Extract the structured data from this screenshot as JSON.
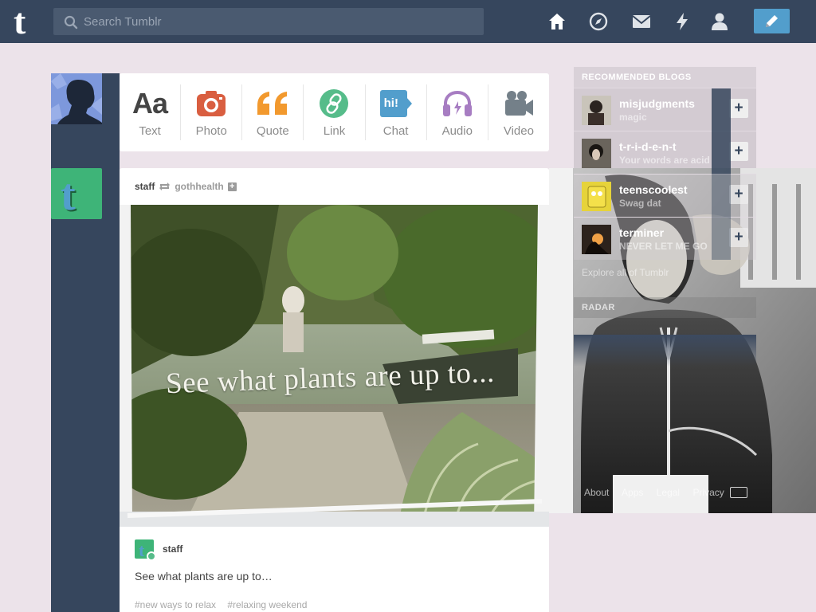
{
  "header": {
    "search_placeholder": "Search Tumblr",
    "nav": [
      "home-icon",
      "explore-icon",
      "inbox-icon",
      "activity-icon",
      "account-icon"
    ],
    "compose_icon": "pencil-icon"
  },
  "post_types": [
    {
      "label": "Text",
      "glyph": "Aa",
      "color": "#444444"
    },
    {
      "label": "Photo",
      "color": "#d95e40"
    },
    {
      "label": "Quote",
      "color": "#f2992e"
    },
    {
      "label": "Link",
      "color": "#56bc8a"
    },
    {
      "label": "Chat",
      "glyph": "hi!",
      "color": "#529ecc"
    },
    {
      "label": "Audio",
      "color": "#a77dc2"
    },
    {
      "label": "Video",
      "color": "#748089"
    }
  ],
  "post": {
    "author": "staff",
    "reblogged_from": "gothhealth",
    "image_caption": "See what plants are up to...",
    "trail_author": "staff",
    "body": "See what plants are up to…",
    "tags": [
      "#new ways to relax",
      "#relaxing weekend"
    ]
  },
  "sidebar": {
    "recommended_heading": "RECOMMENDED BLOGS",
    "blogs": [
      {
        "name": "misjudgments",
        "desc": "magic"
      },
      {
        "name": "t-r-i-d-e-n-t",
        "desc": "Your words are acid"
      },
      {
        "name": "teenscoolest",
        "desc": "Swag dat"
      },
      {
        "name": "terminer",
        "desc": "NEVER LET ME GO"
      }
    ],
    "explore_link": "Explore all of Tumblr",
    "radar_heading": "RADAR",
    "footer": [
      "About",
      "Apps",
      "Legal",
      "Privacy"
    ]
  },
  "colors": {
    "navy": "#36465d",
    "background": "#ece3ea",
    "accent": "#529ecc"
  }
}
